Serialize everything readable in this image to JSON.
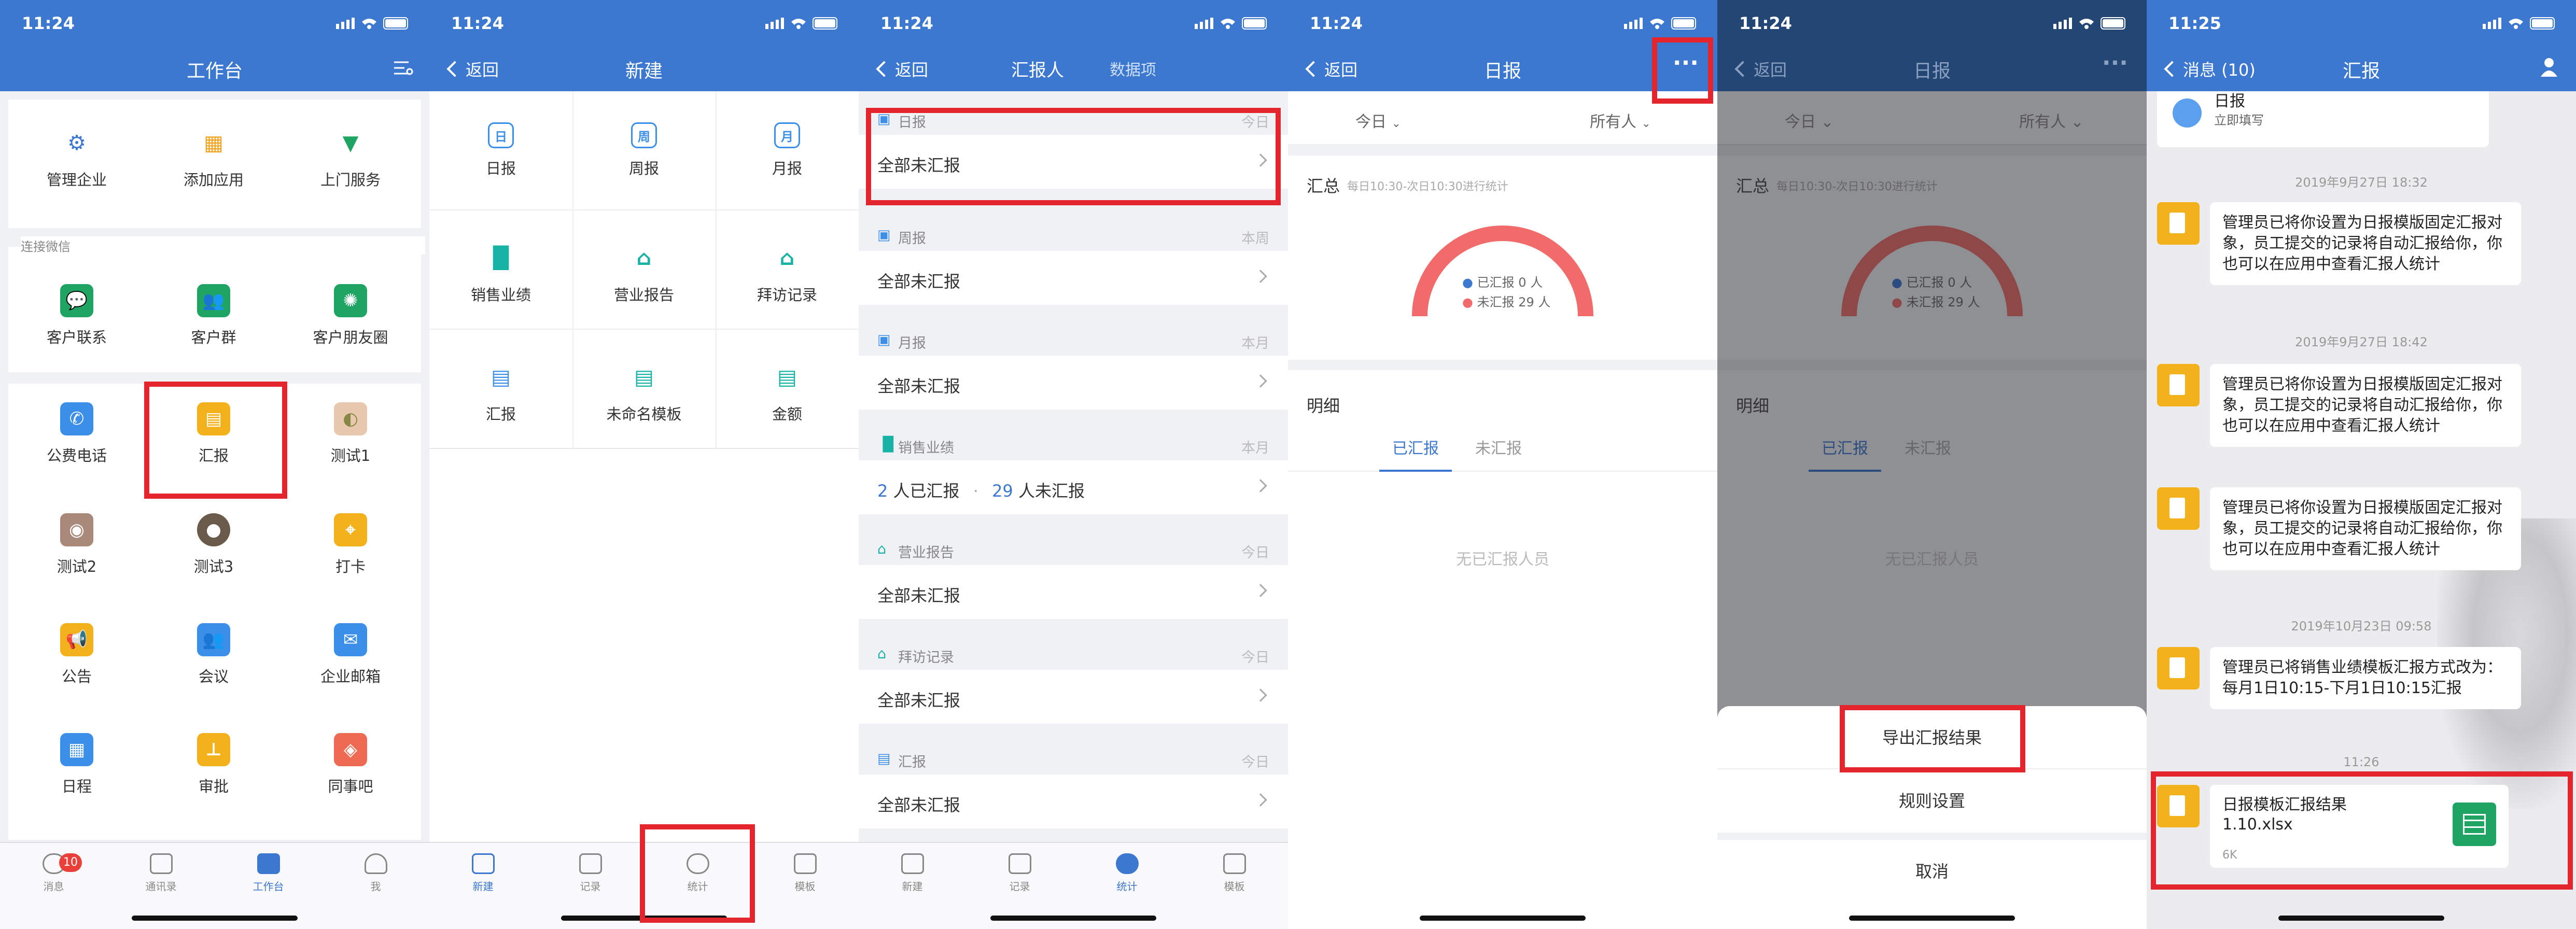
{
  "s1": {
    "time": "11:24",
    "title": "工作台",
    "top": [
      "管理企业",
      "添加应用",
      "上门服务"
    ],
    "wechat_header": "连接微信",
    "wechat": [
      "客户联系",
      "客户群",
      "客户朋友圈"
    ],
    "apps": [
      "公费电话",
      "汇报",
      "测试1",
      "测试2",
      "测试3",
      "打卡",
      "公告",
      "会议",
      "企业邮箱",
      "日程",
      "审批",
      "同事吧"
    ],
    "tabs": [
      "消息",
      "通讯录",
      "工作台",
      "我"
    ],
    "badge": "10"
  },
  "s2": {
    "time": "11:24",
    "back": "返回",
    "title": "新建",
    "items": [
      "日报",
      "周报",
      "月报",
      "销售业绩",
      "营业报告",
      "拜访记录",
      "汇报",
      "未命名模板",
      "金额"
    ],
    "icon_chars": [
      "日",
      "周",
      "月"
    ],
    "tabs": [
      "新建",
      "记录",
      "统计",
      "模板"
    ]
  },
  "s3": {
    "time": "11:24",
    "back": "返回",
    "title": "汇报人",
    "title2": "数据项",
    "sections": [
      {
        "name": "日报",
        "period": "今日",
        "row": "全部未汇报"
      },
      {
        "name": "周报",
        "period": "本周",
        "row": "全部未汇报"
      },
      {
        "name": "月报",
        "period": "本月",
        "row": "全部未汇报"
      },
      {
        "name": "销售业绩",
        "period": "本月",
        "row": ""
      },
      {
        "name": "营业报告",
        "period": "今日",
        "row": "全部未汇报"
      },
      {
        "name": "拜访记录",
        "period": "今日",
        "row": "全部未汇报"
      },
      {
        "name": "汇报",
        "period": "今日",
        "row": "全部未汇报"
      }
    ],
    "sales": {
      "reported": "2",
      "reported_label": "人已汇报",
      "dot": "·",
      "unreported": "29",
      "unreported_label": "人未汇报"
    },
    "tabs": [
      "新建",
      "记录",
      "统计",
      "模板"
    ]
  },
  "s4": {
    "time": "11:24",
    "back": "返回",
    "title": "日报",
    "more": "···",
    "filter_date": "今日",
    "filter_people": "所有人",
    "summary_title": "汇总",
    "summary_note": "每日10:30-次日10:30进行统计",
    "legend_reported": "已汇报 0 人",
    "legend_unreported": "未汇报 29 人",
    "detail_title": "明细",
    "tab_reported": "已汇报",
    "tab_unreported": "未汇报",
    "empty": "无已汇报人员",
    "reported_count": 0,
    "unreported_count": 29
  },
  "s5": {
    "time": "11:24",
    "back": "返回",
    "title": "日报",
    "sheet": [
      "导出汇报结果",
      "规则设置"
    ],
    "cancel": "取消"
  },
  "s6": {
    "time": "11:25",
    "back": "消息 (10)",
    "title": "汇报",
    "first_title": "日报",
    "first_sub": "立即填写",
    "ts1": "2019年9月27日 18:32",
    "ts2": "2019年9月27日 18:42",
    "ts3": "2019年10月23日 09:58",
    "ts4": "11:26",
    "msg1": "管理员已将你设置为日报模版固定汇报对象，员工提交的记录将自动汇报给你，你也可以在应用中查看汇报人统计",
    "msg2": "管理员已将你设置为日报模版固定汇报对象，员工提交的记录将自动汇报给你，你也可以在应用中查看汇报人统计",
    "msg3": "管理员已将你设置为日报模版固定汇报对象，员工提交的记录将自动汇报给你，你也可以在应用中查看汇报人统计",
    "msg4": "管理员已将销售业绩模板汇报方式改为：每月1日10:15-下月1日10:15汇报",
    "file_name": "日报模板汇报结果1.10.xlsx",
    "file_size": "6K"
  },
  "colors": {
    "primary": "#3c78d0",
    "highlight": "#e3262e",
    "arc": "#f26b6b",
    "excel": "#1fa463"
  }
}
